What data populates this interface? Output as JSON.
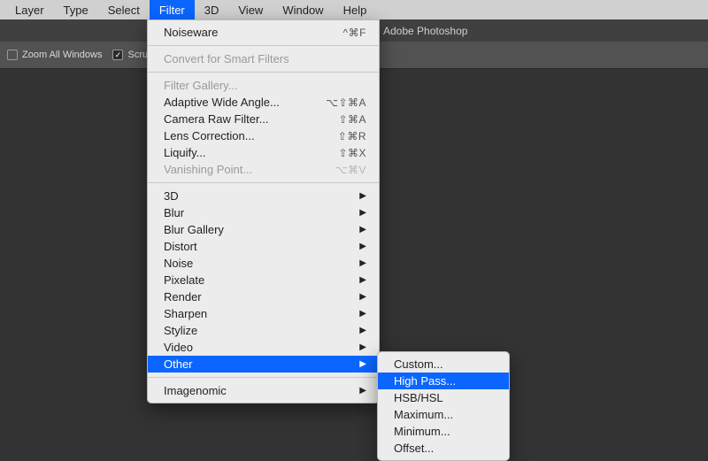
{
  "menubar": {
    "items": [
      "Layer",
      "Type",
      "Select",
      "Filter",
      "3D",
      "View",
      "Window",
      "Help"
    ],
    "active_index": 3
  },
  "titlebar": {
    "app": "Adobe Photoshop"
  },
  "optionbar": {
    "zoom_all_label": "Zoom All Windows",
    "zoom_all_checked": false,
    "scrubby_label": "Scrubb",
    "scrubby_checked": true
  },
  "filter_menu": {
    "last_filter": {
      "label": "Noiseware",
      "shortcut": "^⌘F"
    },
    "smart": {
      "label": "Convert for Smart Filters"
    },
    "group_a": [
      {
        "label": "Filter Gallery...",
        "shortcut": "",
        "disabled": true
      },
      {
        "label": "Adaptive Wide Angle...",
        "shortcut": "⌥⇧⌘A",
        "disabled": false
      },
      {
        "label": "Camera Raw Filter...",
        "shortcut": "⇧⌘A",
        "disabled": false
      },
      {
        "label": "Lens Correction...",
        "shortcut": "⇧⌘R",
        "disabled": false
      },
      {
        "label": "Liquify...",
        "shortcut": "⇧⌘X",
        "disabled": false
      },
      {
        "label": "Vanishing Point...",
        "shortcut": "⌥⌘V",
        "disabled": true
      }
    ],
    "group_b": [
      {
        "label": "3D"
      },
      {
        "label": "Blur"
      },
      {
        "label": "Blur Gallery"
      },
      {
        "label": "Distort"
      },
      {
        "label": "Noise"
      },
      {
        "label": "Pixelate"
      },
      {
        "label": "Render"
      },
      {
        "label": "Sharpen"
      },
      {
        "label": "Stylize"
      },
      {
        "label": "Video"
      },
      {
        "label": "Other",
        "highlight": true
      }
    ],
    "group_c": [
      {
        "label": "Imagenomic"
      }
    ]
  },
  "other_submenu": {
    "items": [
      {
        "label": "Custom..."
      },
      {
        "label": "High Pass...",
        "highlight": true
      },
      {
        "label": "HSB/HSL"
      },
      {
        "label": "Maximum..."
      },
      {
        "label": "Minimum..."
      },
      {
        "label": "Offset..."
      }
    ]
  }
}
